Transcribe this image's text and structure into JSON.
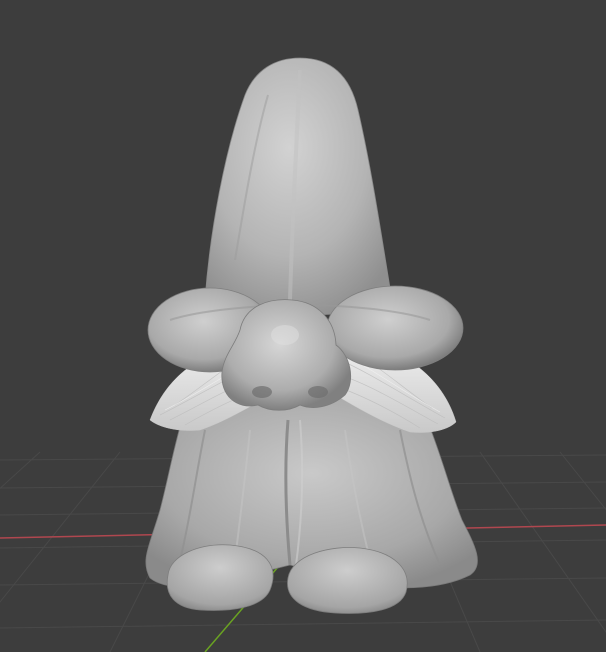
{
  "viewport": {
    "background_color": "#3d3d3d",
    "grid_line_color": "#494949",
    "x_axis_color": "#b0474f",
    "y_axis_color": "#6aa322",
    "model_base_color": "#b5b5b5",
    "model_highlight_color": "#dadada",
    "model_shadow_color": "#6e6e6e",
    "hair_color": "#e6e6e6"
  },
  "scene": {
    "object_icon": "gnome-sculpt-mesh",
    "grid_icon": "floor-grid",
    "axis_icons": [
      "x-axis-line",
      "y-axis-line"
    ]
  }
}
